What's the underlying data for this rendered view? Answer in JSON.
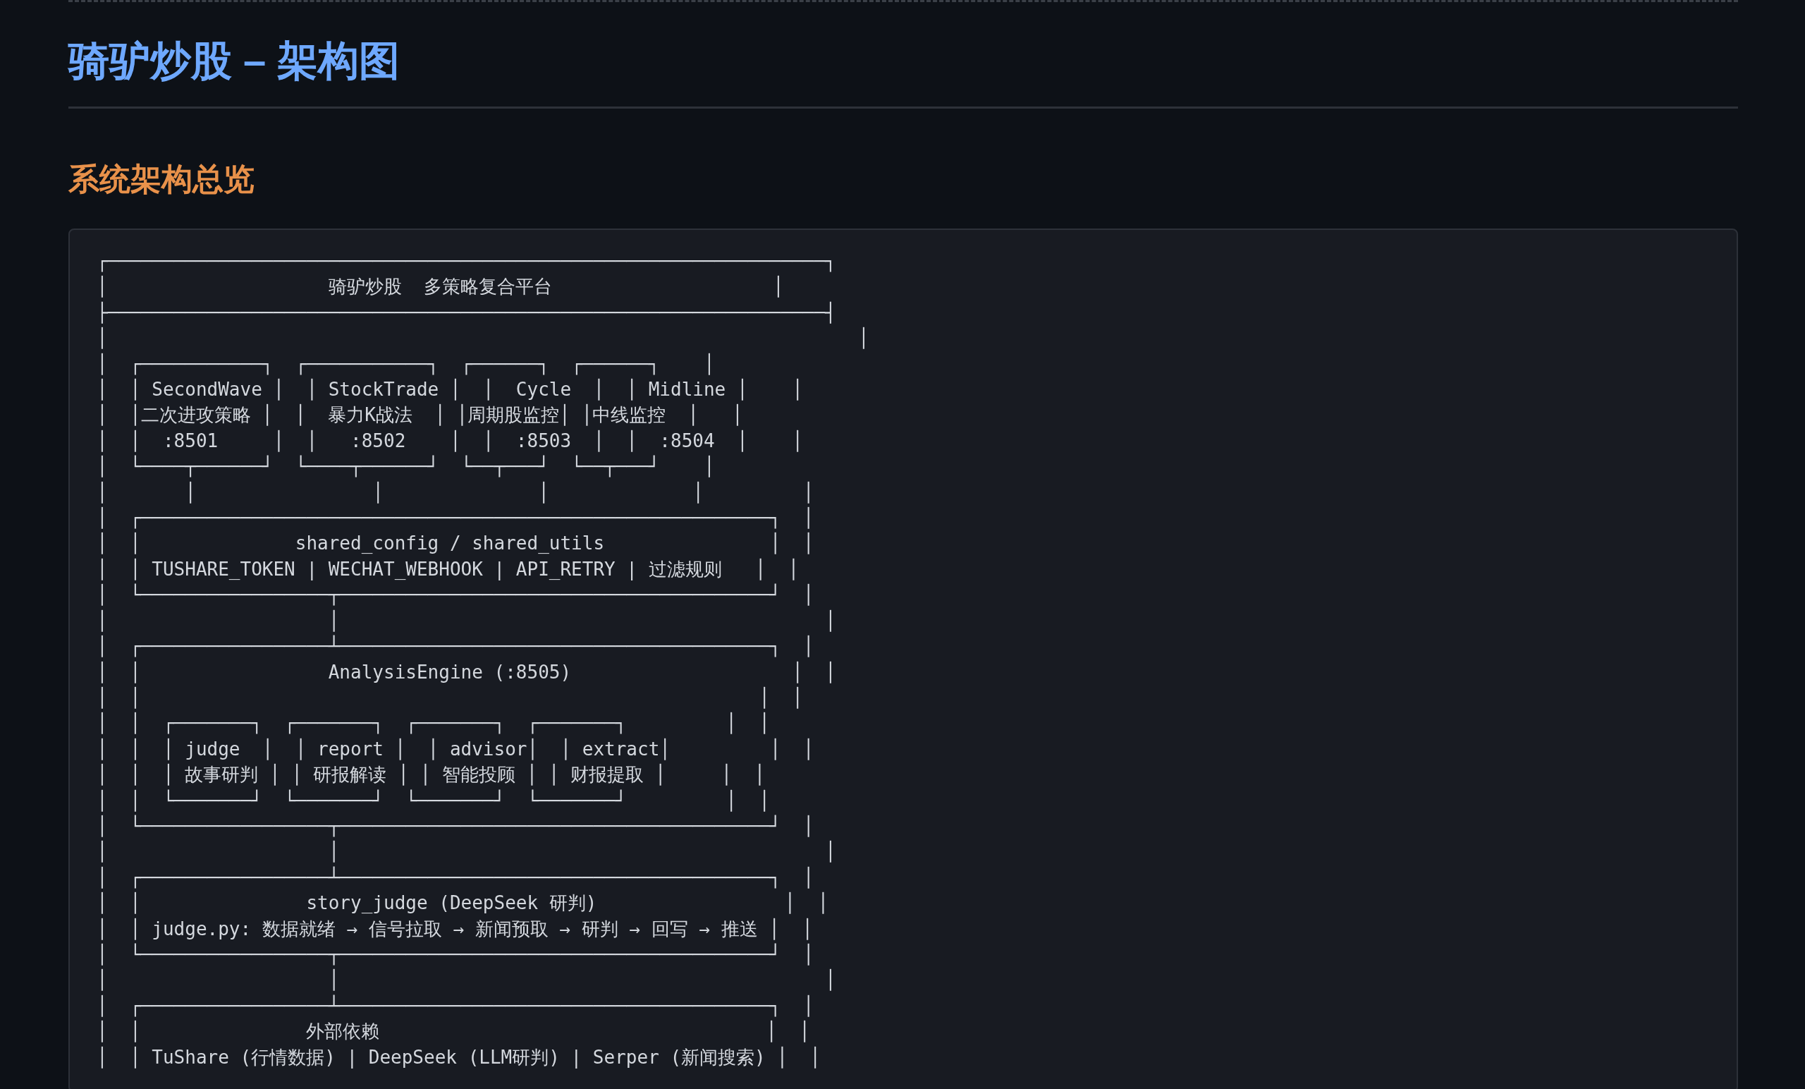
{
  "title": "骑驴炒股 – 架构图",
  "section": {
    "heading": "系统架构总览",
    "diagram_lines": [
      "┌─────────────────────────────────────────────────────────────────┐",
      "│                    骑驴炒股  多策略复合平台                    │",
      "├─────────────────────────────────────────────────────────────────┤",
      "│                                                                    │",
      "│  ┌───────────┐  ┌───────────┐  ┌──────┐  ┌──────┐    │",
      "│  │ SecondWave │  │ StockTrade │  │  Cycle  │  │ Midline │    │",
      "│  │二次进攻策略 │  │  暴力K战法  │ │周期股监控│ │中线监控  │   │",
      "│  │  :8501     │  │   :8502    │  │  :8503  │  │  :8504  │    │",
      "│  └────┬──────┘  └────┬──────┘  └──┬───┘  └──┬───┘    │",
      "│       │                │              │             │         │",
      "│  ┌─────────────────────────────────────────────────────────┐  │",
      "│  │              shared_config / shared_utils               │  │",
      "│  │ TUSHARE_TOKEN | WECHAT_WEBHOOK | API_RETRY | 过滤规则   │  │",
      "│  └─────────────────┬───────────────────────────────────────┘  │",
      "│                    │                                            │",
      "│  ┌─────────────────┴───────────────────────────────────────┐  │",
      "│  │                 AnalysisEngine (:8505)                    │  │",
      "│  │                                                        │  │",
      "│  │  ┌───────┐  ┌───────┐  ┌───────┐  ┌───────┐         │  │",
      "│  │  │ judge  │  │ report │  │ advisor│  │ extract│         │  │",
      "│  │  │ 故事研判 │ │ 研报解读 │ │ 智能投顾 │ │ 财报提取 │     │  │",
      "│  │  └───────┘  └───────┘  └───────┘  └───────┘         │  │",
      "│  └─────────────────┬───────────────────────────────────────┘  │",
      "│                    │                                            │",
      "│  ┌─────────────────┴───────────────────────────────────────┐  │",
      "│  │               story_judge (DeepSeek 研判)                 │  │",
      "│  │ judge.py: 数据就绪 → 信号拉取 → 新闻预取 → 研判 → 回写 → 推送 │  │",
      "│  └─────────────────┬───────────────────────────────────────┘  │",
      "│                    │                                            │",
      "│  ┌─────────────────┴───────────────────────────────────────┐  │",
      "│  │               外部依赖                                   │  │",
      "│  │ TuShare (行情数据) | DeepSeek (LLM研判) | Serper (新闻搜索) │  │"
    ]
  }
}
